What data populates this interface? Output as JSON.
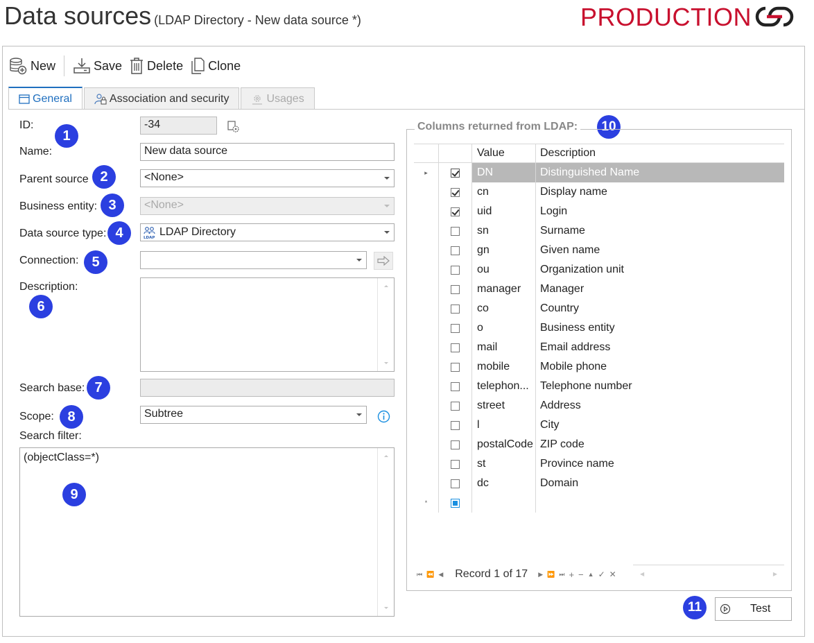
{
  "header": {
    "title": "Data sources",
    "subtitle": "(LDAP Directory - New data source *)",
    "environment": "PRODUCTION",
    "logo_icon": "chain-link-logo"
  },
  "toolbar": {
    "new_label": "New",
    "save_label": "Save",
    "delete_label": "Delete",
    "clone_label": "Clone"
  },
  "tabs": [
    {
      "label": "General",
      "icon": "window-icon",
      "active": true
    },
    {
      "label": "Association and security",
      "icon": "user-lock-icon"
    },
    {
      "label": "Usages",
      "icon": "gears-icon",
      "disabled": true
    }
  ],
  "form": {
    "id_label": "ID:",
    "id_value": "-34",
    "name_label": "Name:",
    "name_value": "New data source",
    "parent_label": "Parent source",
    "parent_value": "<None>",
    "business_entity_label": "Business entity:",
    "business_entity_value": "<None>",
    "type_label": "Data source type:",
    "type_value": "LDAP Directory",
    "connection_label": "Connection:",
    "connection_value": "",
    "description_label": "Description:",
    "description_value": "",
    "search_base_label": "Search base:",
    "search_base_value": "",
    "scope_label": "Scope:",
    "scope_value": "Subtree",
    "search_filter_label": "Search filter:",
    "search_filter_value": "(objectClass=*)"
  },
  "badges": [
    "1",
    "2",
    "3",
    "4",
    "5",
    "6",
    "7",
    "8",
    "9",
    "10",
    "11"
  ],
  "columns_panel": {
    "title": "Columns returned from LDAP:",
    "headers": {
      "value": "Value",
      "description": "Description"
    },
    "rows": [
      {
        "checked": true,
        "value": "DN",
        "description": "Distinguished Name",
        "selected": true
      },
      {
        "checked": true,
        "value": "cn",
        "description": "Display name"
      },
      {
        "checked": true,
        "value": "uid",
        "description": "Login"
      },
      {
        "checked": false,
        "value": "sn",
        "description": "Surname"
      },
      {
        "checked": false,
        "value": "gn",
        "description": "Given name"
      },
      {
        "checked": false,
        "value": "ou",
        "description": "Organization unit"
      },
      {
        "checked": false,
        "value": "manager",
        "description": "Manager"
      },
      {
        "checked": false,
        "value": "co",
        "description": "Country"
      },
      {
        "checked": false,
        "value": "o",
        "description": "Business entity"
      },
      {
        "checked": false,
        "value": "mail",
        "description": "Email address"
      },
      {
        "checked": false,
        "value": "mobile",
        "description": "Mobile phone"
      },
      {
        "checked": false,
        "value": "telephon...",
        "description": "Telephone number"
      },
      {
        "checked": false,
        "value": "street",
        "description": "Address"
      },
      {
        "checked": false,
        "value": "l",
        "description": "City"
      },
      {
        "checked": false,
        "value": "postalCode",
        "description": "ZIP code"
      },
      {
        "checked": false,
        "value": "st",
        "description": "Province name"
      },
      {
        "checked": false,
        "value": "dc",
        "description": "Domain"
      }
    ],
    "new_row_marker": "*",
    "record_text": "Record 1 of 17"
  },
  "test_button_label": "Test",
  "colors": {
    "accent": "#1f6fbf",
    "environment": "#c8102e",
    "badge": "#2b3fe0",
    "selected_row": "#b8b8b8"
  }
}
